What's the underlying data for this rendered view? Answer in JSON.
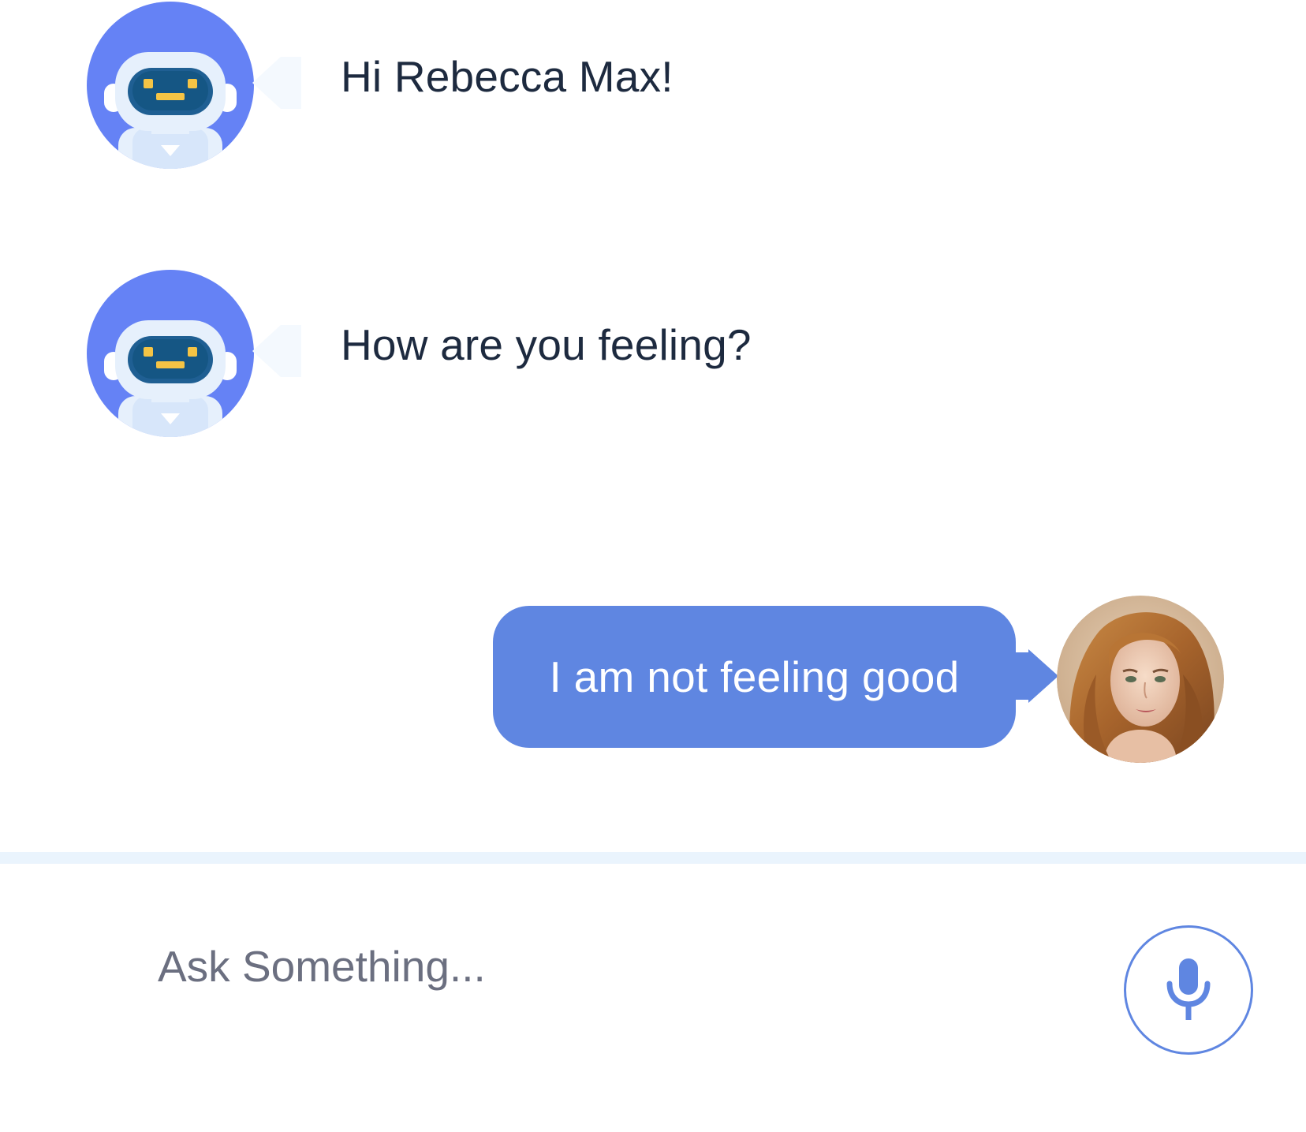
{
  "messages": [
    {
      "sender": "bot",
      "text": "Hi Rebecca Max!",
      "avatar_icon": "robot-avatar-icon"
    },
    {
      "sender": "bot",
      "text": "How are you feeling?",
      "avatar_icon": "robot-avatar-icon"
    },
    {
      "sender": "user",
      "text": "I am not feeling good",
      "avatar_icon": "user-photo-avatar"
    }
  ],
  "composer": {
    "placeholder": "Ask Something...",
    "value": "",
    "mic_icon": "microphone-icon"
  },
  "colors": {
    "accent": "#5f86e1",
    "bot_avatar_bg": "#6582f5",
    "bot_text": "#1d2a3f",
    "user_bubble_text": "#ffffff",
    "divider": "#eaf4fd",
    "background": "#ffffff"
  }
}
